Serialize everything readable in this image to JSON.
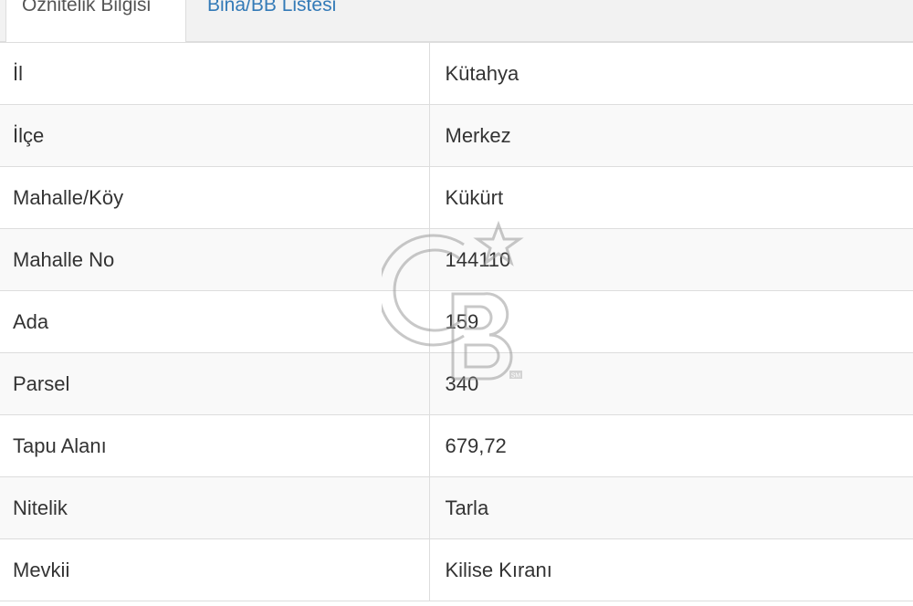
{
  "tabs": [
    {
      "label": "Öznitelik Bilgisi",
      "active": true
    },
    {
      "label": "Bina/BB Listesi",
      "active": false
    }
  ],
  "rows": [
    {
      "label": "İl",
      "value": "Kütahya"
    },
    {
      "label": "İlçe",
      "value": "Merkez"
    },
    {
      "label": "Mahalle/Köy",
      "value": "Kükürt"
    },
    {
      "label": "Mahalle No",
      "value": "144110"
    },
    {
      "label": "Ada",
      "value": "159"
    },
    {
      "label": "Parsel",
      "value": "340"
    },
    {
      "label": "Tapu Alanı",
      "value": "679,72"
    },
    {
      "label": "Nitelik",
      "value": "Tarla"
    },
    {
      "label": "Mevkii",
      "value": "Kilise Kıranı"
    }
  ],
  "watermark": {
    "mark": "SM"
  },
  "colors": {
    "link": "#337ab7",
    "border": "#dddddd",
    "stripe": "#f9f9f9",
    "text": "#333333"
  }
}
